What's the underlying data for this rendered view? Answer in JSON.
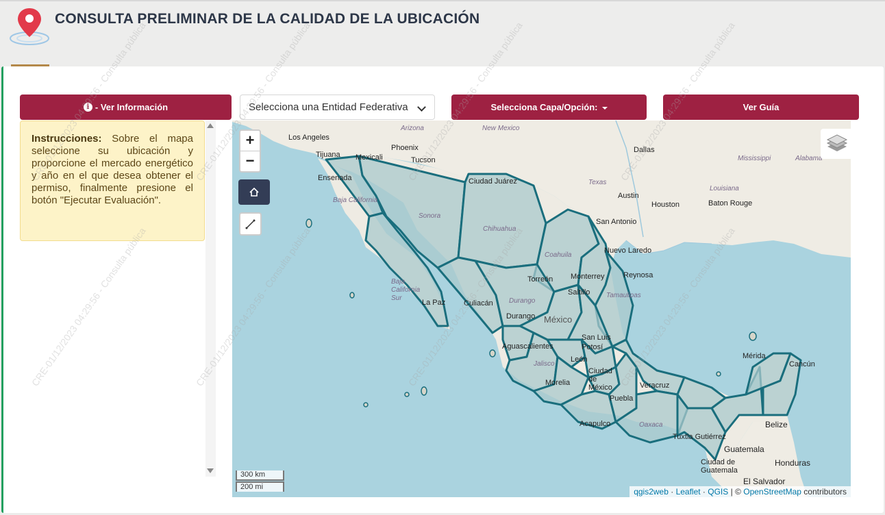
{
  "header": {
    "title": "CONSULTA PRELIMINAR DE LA CALIDAD DE LA UBICACIÓN"
  },
  "toolbar": {
    "info_label": "- Ver Información",
    "entity_select": "Selecciona una Entidad Federativa",
    "capa_label": "Selecciona Capa/Opción:",
    "guia_label": "Ver Guía"
  },
  "instructions": {
    "bold": "Instrucciones:",
    "text": " Sobre el mapa seleccione su ubicación y proporcione el mercado energético y año en el que desea obtener el permiso, finalmente presione el botón \"Ejecutar Evaluación\"."
  },
  "map": {
    "zoom_in": "+",
    "zoom_out": "−",
    "scale_km": "300 km",
    "scale_mi": "200 mi",
    "attribution": {
      "qgis2web": "qgis2web",
      "sep1": " · ",
      "leaflet": "Leaflet",
      "sep2": " · ",
      "qgis": "QGIS",
      "sep3": " | © ",
      "osm": "OpenStreetMap",
      "contrib": " contributors"
    },
    "labels": {
      "los_angeles": "Los Angeles",
      "tijuana": "Tijuana",
      "mexicali": "Mexicali",
      "phoenix": "Phoenix",
      "tucson": "Tucson",
      "arizona": "Arizona",
      "new_mexico": "New Mexico",
      "dallas": "Dallas",
      "mississippi": "Mississippi",
      "alabama": "Alabama",
      "texas": "Texas",
      "louisiana": "Louisiana",
      "austin": "Austin",
      "houston": "Houston",
      "baton_rouge": "Baton Rouge",
      "san_antonio": "San Antonio",
      "ensenada": "Ensenada",
      "ciudad_juarez": "Ciudad Juárez",
      "baja_california": "Baja California",
      "sonora": "Sonora",
      "chihuahua": "Chihuahua",
      "coahuila": "Coahuila",
      "nuevo_laredo": "Nuevo Laredo",
      "reynosa": "Reynosa",
      "monterrey": "Monterrey",
      "saltillo": "Saltillo",
      "torreon": "Torreón",
      "tamaulipas": "Tamaulipas",
      "baja_california_sur": "Baja California Sur",
      "la_paz": "La Paz",
      "culiacan": "Culiacán",
      "durango": "Durango",
      "durango_city": "Durango",
      "mexico": "México",
      "san_luis_potosi": "San Luis Potosí",
      "aguascalientes": "Aguascalientes",
      "leon": "León",
      "jalisco": "Jalisco",
      "ciudad_mexico": "Ciudad de México",
      "morelia": "Morelia",
      "puebla": "Puebla",
      "veracruz": "Veracruz",
      "acapulco": "Acapulco",
      "oaxaca": "Oaxaca",
      "tuxtla": "Tuxtla Gutiérrez",
      "merida": "Mérida",
      "cancun": "Cancún",
      "belize": "Belize",
      "guatemala": "Guatemala",
      "ciudad_guatemala": "Ciudad de Guatemala",
      "honduras": "Honduras",
      "el_salvador": "El Salvador"
    }
  },
  "watermark": "CRE-01/12/2023 04:29:56 - Consulta pública",
  "colors": {
    "brand": "#9e2142",
    "region_outline": "#1a6e7d",
    "water": "#aad3df"
  }
}
